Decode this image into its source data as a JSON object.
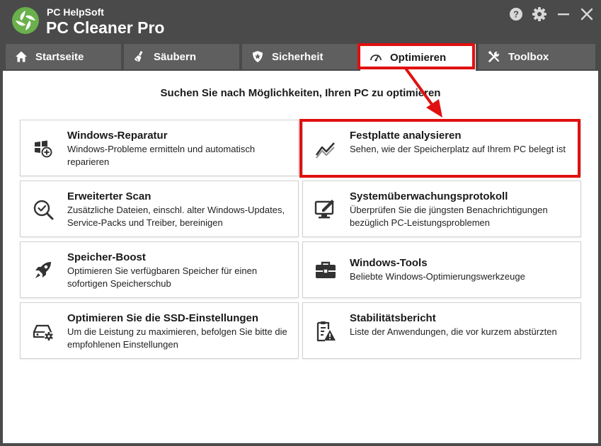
{
  "app": {
    "brand_small": "PC HelpSoft",
    "brand_name": "PC Cleaner Pro",
    "window_controls": [
      "help-icon",
      "gear-icon",
      "minimize-icon",
      "close-icon"
    ]
  },
  "tabs": [
    {
      "label": "Startseite",
      "icon": "home-icon",
      "active": false
    },
    {
      "label": "Säubern",
      "icon": "broom-icon",
      "active": false
    },
    {
      "label": "Sicherheit",
      "icon": "shield-icon",
      "active": false
    },
    {
      "label": "Optimieren",
      "icon": "speedometer-icon",
      "active": true
    },
    {
      "label": "Toolbox",
      "icon": "tools-icon",
      "active": false
    }
  ],
  "main": {
    "heading": "Suchen Sie nach Möglichkeiten, Ihren PC zu optimieren",
    "cards": [
      {
        "title": "Windows-Reparatur",
        "description": "Windows-Probleme ermitteln und automatisch reparieren",
        "icon": "windows-repair-icon"
      },
      {
        "title": "Festplatte analysieren",
        "description": "Sehen, wie der Speicherplatz auf Ihrem PC belegt ist",
        "icon": "chart-line-icon"
      },
      {
        "title": "Erweiterter Scan",
        "description": "Zusätzliche Dateien, einschl. alter Windows-Updates, Service-Packs und Treiber, bereinigen",
        "icon": "magnifier-check-icon"
      },
      {
        "title": "Systemüberwachungsprotokoll",
        "description": "Überprüfen Sie die jüngsten Benachrichtigungen bezüglich PC-Leistungsproblemen",
        "icon": "monitor-edit-icon"
      },
      {
        "title": "Speicher-Boost",
        "description": "Optimieren Sie verfügbaren Speicher für einen sofortigen Speicherschub",
        "icon": "rocket-icon"
      },
      {
        "title": "Windows-Tools",
        "description": "Beliebte Windows-Optimierungswerkzeuge",
        "icon": "toolbox-icon"
      },
      {
        "title": "Optimieren Sie die SSD-Einstellungen",
        "description": "Um die Leistung zu maximieren, befolgen Sie bitte die empfohlenen Einstellungen",
        "icon": "ssd-gear-icon"
      },
      {
        "title": "Stabilitätsbericht",
        "description": "Liste der Anwendungen, die vor kurzem abstürzten",
        "icon": "report-warning-icon"
      }
    ]
  },
  "colors": {
    "titlebar": "#4a4a4a",
    "tab_bg": "#5f5f5f",
    "logo_green": "#6ab04c",
    "highlight_red": "#e01010"
  }
}
